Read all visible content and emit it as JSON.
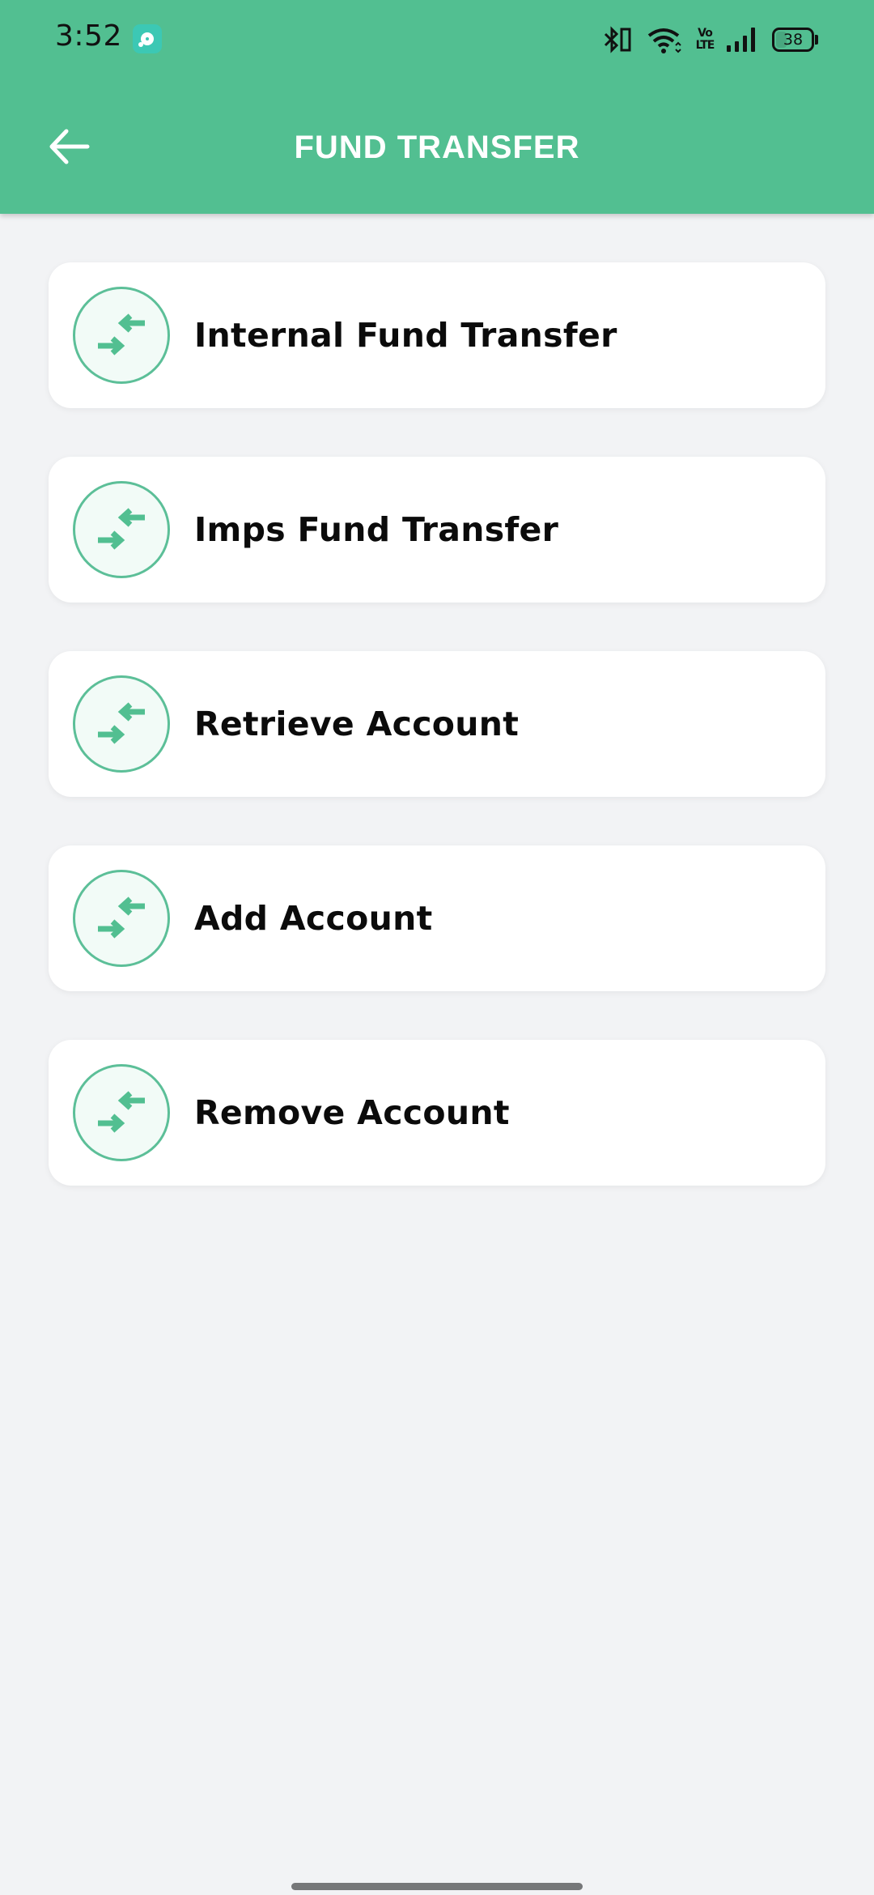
{
  "status_bar": {
    "time": "3:52",
    "notification_icon": "music-player-icon",
    "icons": [
      "bluetooth-icon",
      "wifi-icon",
      "volte-icon",
      "signal-icon",
      "battery-icon"
    ],
    "volte_line1": "Vo",
    "volte_line2": "LTE",
    "battery_level": "38",
    "battery_percent": 38
  },
  "app_bar": {
    "title": "FUND TRANSFER",
    "back_icon": "arrow-left-icon",
    "background_color": "#52bf91"
  },
  "menu": {
    "items": [
      {
        "label": "Internal Fund Transfer",
        "icon": "transfer-arrows-icon"
      },
      {
        "label": "Imps Fund Transfer",
        "icon": "transfer-arrows-icon"
      },
      {
        "label": "Retrieve Account",
        "icon": "transfer-arrows-icon"
      },
      {
        "label": "Add Account",
        "icon": "transfer-arrows-icon"
      },
      {
        "label": "Remove Account",
        "icon": "transfer-arrows-icon"
      }
    ],
    "accent_color": "#5cbf98"
  }
}
